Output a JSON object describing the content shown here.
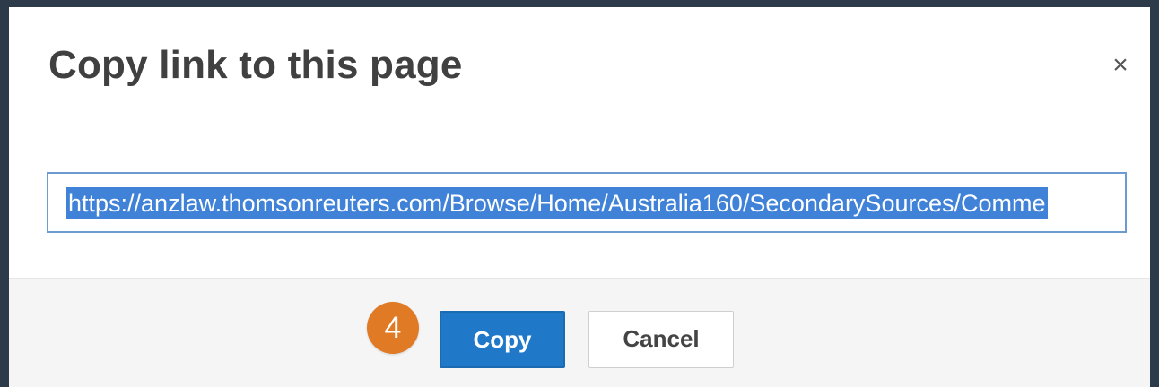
{
  "dialog": {
    "title": "Copy link to this page",
    "close_glyph": "×",
    "close_icon": "close-icon"
  },
  "link": {
    "url": "https://anzlaw.thomsonreuters.com/Browse/Home/Australia160/SecondarySources/Comme"
  },
  "footer": {
    "step_number": "4",
    "copy_label": "Copy",
    "cancel_label": "Cancel"
  },
  "colors": {
    "primary_button": "#1f78c8",
    "step_badge": "#e07a25",
    "selection_highlight": "#3f82d8"
  }
}
